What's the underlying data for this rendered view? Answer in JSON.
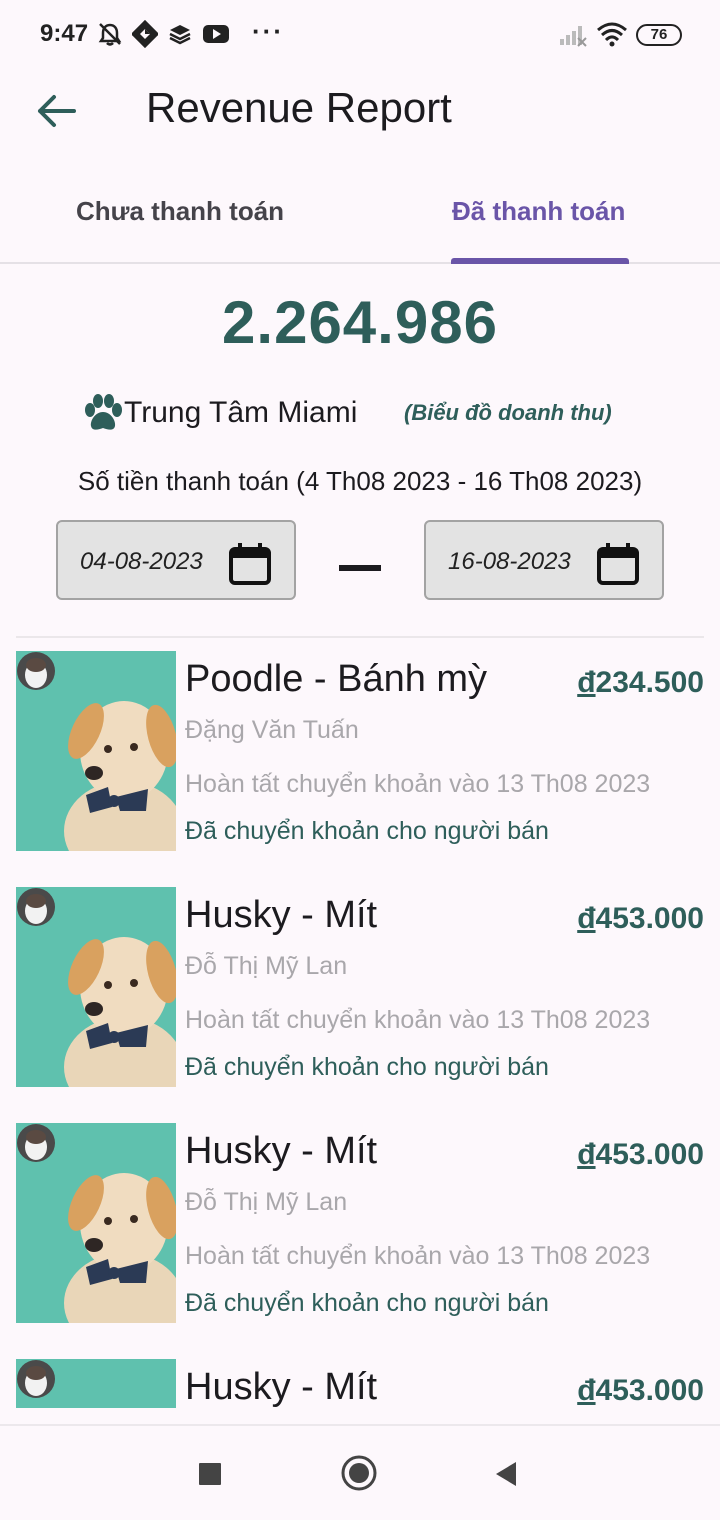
{
  "status_bar": {
    "time": "9:47",
    "dots": "···",
    "battery": "76",
    "icons": [
      "alarm-off-icon",
      "app-icon",
      "stack-icon",
      "youtube-icon",
      "signal-icon",
      "wifi-icon",
      "battery-icon"
    ]
  },
  "app_bar": {
    "back_icon": "arrow-left-icon",
    "title": "Revenue Report"
  },
  "tabs": [
    {
      "label": "Chưa thanh toán",
      "selected": false
    },
    {
      "label": "Đã thanh toán",
      "selected": true
    }
  ],
  "summary": {
    "total": "2.264.986",
    "center_icon": "paw-icon",
    "center_name": "Trung Tâm Miami",
    "chart_link": "(Biểu đồ doanh thu)",
    "range_caption": "Số tiền thanh toán (4 Th08 2023 - 16 Th08 2023)"
  },
  "date_range": {
    "start": "04-08-2023",
    "end": "16-08-2023",
    "icon": "calendar-icon"
  },
  "transactions": [
    {
      "title": "Poodle - Bánh mỳ",
      "currency": "đ",
      "amount": "234.500",
      "buyer": "Đặng Văn Tuấn",
      "completed": "Hoàn tất chuyển khoản vào 13 Th08 2023",
      "status": "Đã chuyển khoản cho người bán"
    },
    {
      "title": "Husky - Mít",
      "currency": "đ",
      "amount": "453.000",
      "buyer": "Đỗ Thị Mỹ Lan",
      "completed": "Hoàn tất chuyển khoản vào 13 Th08 2023",
      "status": "Đã chuyển khoản cho người bán"
    },
    {
      "title": "Husky - Mít",
      "currency": "đ",
      "amount": "453.000",
      "buyer": "Đỗ Thị Mỹ Lan",
      "completed": "Hoàn tất chuyển khoản vào 13 Th08 2023",
      "status": "Đã chuyển khoản cho người bán"
    },
    {
      "title": "Husky - Mít",
      "currency": "đ",
      "amount": "453.000",
      "buyer": "",
      "completed": "",
      "status": ""
    }
  ],
  "colors": {
    "accent": "#2e5e5a",
    "tab_active": "#6a55a8",
    "muted_text": "#a9a7ab",
    "background": "#fdf8fc"
  },
  "nav_bar": {
    "buttons": [
      "square-recents-icon",
      "circle-home-icon",
      "triangle-back-icon"
    ]
  }
}
